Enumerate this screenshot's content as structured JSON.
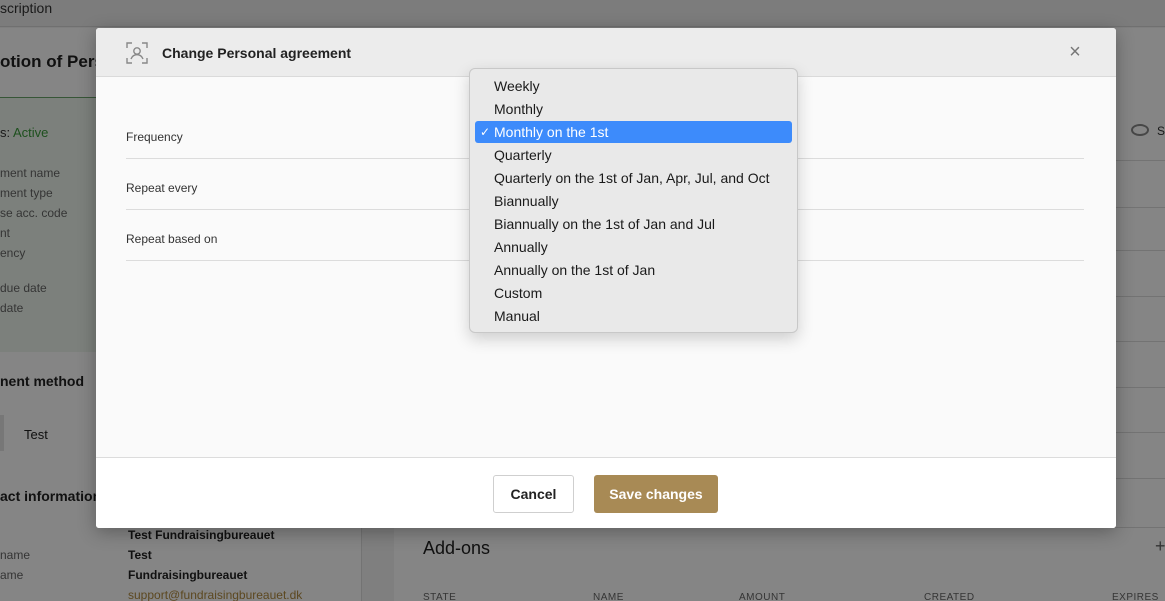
{
  "background": {
    "topbar_text": "scription",
    "heading": "otion of Pers",
    "status_prefix": "s: ",
    "status_value": "Active",
    "fields": [
      "ment name",
      "ment type",
      "se acc. code",
      "nt",
      "ency",
      "due date",
      "date"
    ],
    "payment_section": "nent method",
    "payment_test": "Test",
    "contact_section": "act information",
    "contact_labels": [
      "name",
      "ame"
    ],
    "contact_values": [
      "Test Fundraisingbureauet",
      "Test",
      "Fundraisingbureauet"
    ],
    "contact_link": "support@fundraisingbureauet.dk",
    "addons_title": "Add-ons",
    "addons_columns": [
      "STATE",
      "NAME",
      "AMOUNT",
      "CREATED",
      "EXPIRES"
    ],
    "eye_label": "S",
    "plus": "+"
  },
  "modal": {
    "title": "Change Personal agreement",
    "icon": "person-frame-icon",
    "close_symbol": "×",
    "rows": [
      {
        "label": "Frequency"
      },
      {
        "label": "Repeat every"
      },
      {
        "label": "Repeat based on"
      }
    ],
    "cancel_label": "Cancel",
    "save_label": "Save changes",
    "accent": "#a88a55"
  },
  "dropdown": {
    "selected_index": 2,
    "check_symbol": "✓",
    "selected_color": "#3d8bfb",
    "options": [
      "Weekly",
      "Monthly",
      "Monthly on the 1st",
      "Quarterly",
      "Quarterly on the 1st of Jan, Apr, Jul, and Oct",
      "Biannually",
      "Biannually on the 1st of Jan and Jul",
      "Annually",
      "Annually on the 1st of Jan",
      "Custom",
      "Manual"
    ]
  }
}
